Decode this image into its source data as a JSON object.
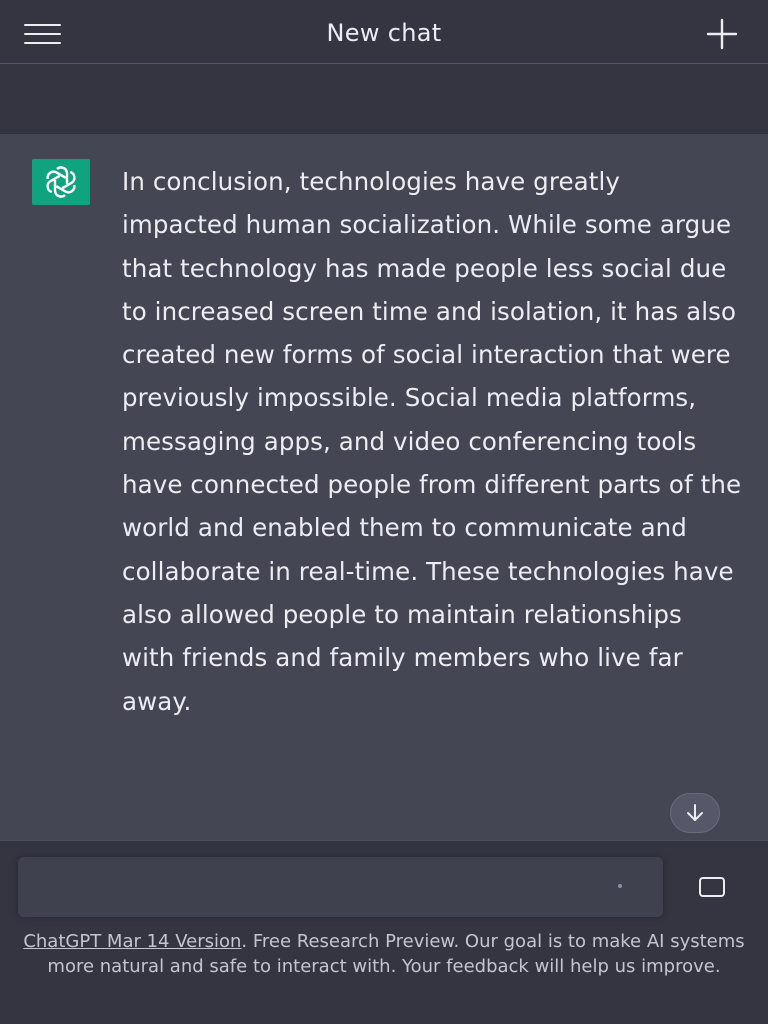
{
  "header": {
    "title": "New chat",
    "menu_icon": "hamburger-menu-icon",
    "new_chat_icon": "plus-icon"
  },
  "message": {
    "avatar_icon": "openai-logo-icon",
    "text": "In conclusion, technologies have greatly impacted human socialization. While some argue that technology has made people less social due to increased screen time and isolation, it has also created new forms of social interaction that were previously impossible. Social media platforms, messaging apps, and video conferencing tools have connected people from different parts of the world and enabled them to communicate and collaborate in real-time. These technologies have also allowed people to maintain relationships with friends and family members who live far away.",
    "scroll_icon": "arrow-down-icon"
  },
  "composer": {
    "value": "",
    "send_icon": "stop-square-icon"
  },
  "footer": {
    "link_text": "ChatGPT Mar 14 Version",
    "text": ". Free Research Preview. Our goal is to make AI systems more natural and safe to interact with. Your feedback will help us improve."
  },
  "colors": {
    "background": "#343541",
    "message_background": "#444654",
    "accent": "#10a37f",
    "text": "#ececf1"
  }
}
